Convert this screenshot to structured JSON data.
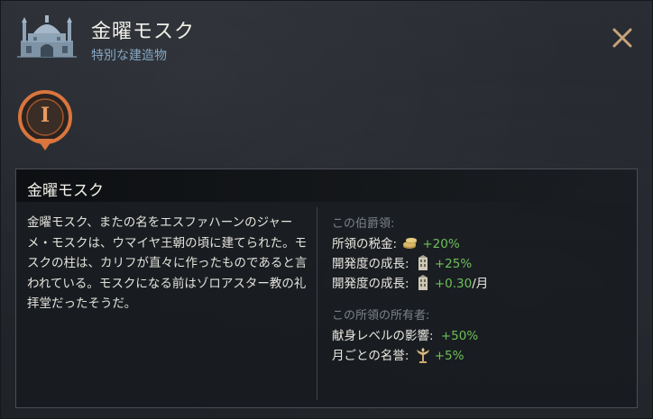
{
  "header": {
    "title": "金曜モスク",
    "subtitle": "特別な建造物",
    "icon": "mosque-icon",
    "close_icon": "close-icon"
  },
  "marker": {
    "numeral": "I",
    "icon": "map-marker-icon"
  },
  "details": {
    "title": "金曜モスク",
    "description": "金曜モスク、またの名をエスファハーンのジャーメ・モスクは、ウマイヤ王朝の頃に建てられた。モスクの柱は、カリフが直々に作ったものであると言われている。モスクになる前はゾロアスター教の礼拝堂だったそうだ。"
  },
  "county_effects": {
    "label": "この伯爵領:",
    "items": [
      {
        "name": "所領の税金:",
        "icon": "coins-icon",
        "value": "+20%",
        "suffix": ""
      },
      {
        "name": "開発度の成長:",
        "icon": "development-icon",
        "value": "+25%",
        "suffix": ""
      },
      {
        "name": "開発度の成長:",
        "icon": "development-icon",
        "value": "+0.30",
        "suffix": "/月"
      }
    ]
  },
  "holder_effects": {
    "label": "この所領の所有者:",
    "items": [
      {
        "name": "献身レベルの影響:",
        "icon": "",
        "value": "+50%",
        "suffix": ""
      },
      {
        "name": "月ごとの名誉:",
        "icon": "prestige-icon",
        "value": "+5%",
        "suffix": ""
      }
    ]
  },
  "colors": {
    "positive": "#6fbf5a",
    "subtitle": "#86a7c4",
    "marker_orange": "#d9753d"
  }
}
